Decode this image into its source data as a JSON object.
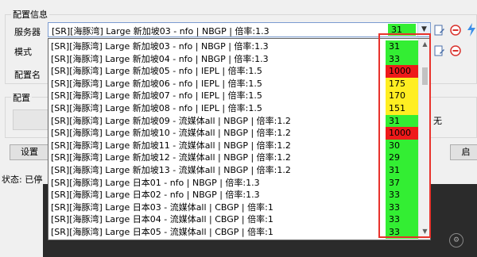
{
  "config_group": {
    "title": "配置信息"
  },
  "labels": {
    "server": "服务器",
    "mode": "模式",
    "config_name": "配置名",
    "config_section": "配置",
    "settings": "设置",
    "status_prefix": "状态: 已停",
    "right_label": "无",
    "right_button": "启"
  },
  "server_select": {
    "selected_name": "[SR][海豚湾] Large 新加坡03 - nfo | NBGP | 倍率:1.3",
    "selected_latency": "31"
  },
  "server_options": [
    {
      "name": "[SR][海豚湾] Large 新加坡03 - nfo | NBGP | 倍率:1.3",
      "latency": "31",
      "color": "#33ee33"
    },
    {
      "name": "[SR][海豚湾] Large 新加坡04 - nfo | NBGP | 倍率:1.3",
      "latency": "33",
      "color": "#33ee33"
    },
    {
      "name": "[SR][海豚湾] Large 新加坡05 - nfo | IEPL | 倍率:1.5",
      "latency": "1000",
      "color": "#ee1a1a"
    },
    {
      "name": "[SR][海豚湾] Large 新加坡06 - nfo | IEPL | 倍率:1.5",
      "latency": "175",
      "color": "#ffee22"
    },
    {
      "name": "[SR][海豚湾] Large 新加坡07 - nfo | IEPL | 倍率:1.5",
      "latency": "170",
      "color": "#ffee22"
    },
    {
      "name": "[SR][海豚湾] Large 新加坡08 - nfo | IEPL | 倍率:1.5",
      "latency": "151",
      "color": "#ffee22"
    },
    {
      "name": "[SR][海豚湾] Large 新加坡09 - 流媒体all | NBGP | 倍率:1.2",
      "latency": "31",
      "color": "#33ee33"
    },
    {
      "name": "[SR][海豚湾] Large 新加坡10 - 流媒体all | NBGP | 倍率:1.2",
      "latency": "1000",
      "color": "#ee1a1a"
    },
    {
      "name": "[SR][海豚湾] Large 新加坡11 - 流媒体all | NBGP | 倍率:1.2",
      "latency": "30",
      "color": "#33ee33"
    },
    {
      "name": "[SR][海豚湾] Large 新加坡12 - 流媒体all | NBGP | 倍率:1.2",
      "latency": "29",
      "color": "#33ee33"
    },
    {
      "name": "[SR][海豚湾] Large 新加坡13 - 流媒体all | NBGP | 倍率:1.2",
      "latency": "31",
      "color": "#33ee33"
    },
    {
      "name": "[SR][海豚湾] Large 日本01 - nfo | NBGP | 倍率:1.3",
      "latency": "37",
      "color": "#33ee33"
    },
    {
      "name": "[SR][海豚湾] Large 日本02 - nfo | NBGP | 倍率:1.3",
      "latency": "33",
      "color": "#33ee33"
    },
    {
      "name": "[SR][海豚湾] Large 日本03 - 流媒体all | CBGP | 倍率:1",
      "latency": "33",
      "color": "#33ee33"
    },
    {
      "name": "[SR][海豚湾] Large 日本04 - 流媒体all | CBGP | 倍率:1",
      "latency": "33",
      "color": "#33ee33"
    },
    {
      "name": "[SR][海豚湾] Large 日本05 - 流媒体all | CBGP | 倍率:1",
      "latency": "33",
      "color": "#33ee33"
    }
  ],
  "scroll_position": 0.0,
  "colors": {
    "latency_good": "#33ee33",
    "latency_medium": "#ffee22",
    "latency_bad": "#ee1a1a",
    "highlight_box": "#e8322c"
  },
  "icons": [
    "edit-server-icon",
    "remove-server-icon",
    "flash-icon",
    "edit-mode-icon",
    "remove-mode-icon",
    "chevron-down-icon",
    "scroll-up-icon",
    "scroll-down-icon"
  ]
}
